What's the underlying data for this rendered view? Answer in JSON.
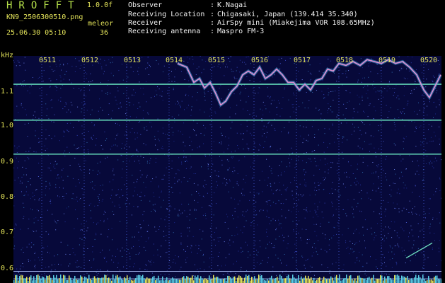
{
  "header": {
    "app_title": "HROFFT",
    "version": "1.0.0f",
    "filename": "KN9_2506300510.png",
    "datetime": "25.06.30 05:10",
    "counter_label": "meleor",
    "counter_value": "36"
  },
  "info": [
    {
      "key": "Observer",
      "value": "K.Nagai"
    },
    {
      "key": "Receiving Location",
      "value": "Chigasaki, Japan (139.414 35.340)"
    },
    {
      "key": "Receiver",
      "value": "AirSpy mini (Miakejima VOR 108.65MHz)"
    },
    {
      "key": "Receiving antenna",
      "value": "Maspro FM-3"
    }
  ],
  "chart_data": {
    "type": "heatmap",
    "ylabel": "kHz",
    "ylim": [
      0.58,
      1.22
    ],
    "yticks": [
      "1.1",
      "1.0",
      "0.9",
      "0.8",
      "0.7",
      "0.6"
    ],
    "xticks": [
      "0511",
      "0512",
      "0513",
      "0514",
      "0515",
      "0516",
      "0517",
      "0518",
      "0519",
      "0520"
    ],
    "carrier_lines_khz": [
      1.115,
      1.02,
      0.93,
      0.62,
      0.6
    ],
    "colors": {
      "background": "#07093a",
      "carrier": "#5fd2b4",
      "trace": "#e28fcf",
      "axis_text": "#e3e35a"
    }
  }
}
